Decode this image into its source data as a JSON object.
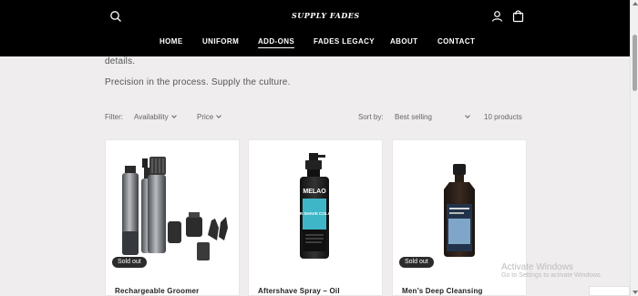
{
  "header": {
    "logo_text": "SUPPLY FADES",
    "nav": [
      {
        "label": "HOME"
      },
      {
        "label": "UNIFORM"
      },
      {
        "label": "ADD-ONS"
      },
      {
        "label": "FADES LEGACY"
      },
      {
        "label": "ABOUT"
      },
      {
        "label": "CONTACT"
      }
    ],
    "active_nav": "ADD-ONS",
    "icons": [
      "search-icon",
      "account-icon",
      "cart-icon"
    ]
  },
  "intro": {
    "line1": "details.",
    "line2": "Precision in the process. Supply the culture."
  },
  "filters": {
    "label": "Filter:",
    "availability": "Availability",
    "price": "Price",
    "sort_label": "Sort by:",
    "sort_value": "Best selling",
    "count": "10 products"
  },
  "products": [
    {
      "title": "Rechargeable Groomer",
      "badge": "Sold out"
    },
    {
      "title": "Aftershave Spray – Oil",
      "badge": "",
      "bottle_label": "AFTER SHAVE COLOGNE",
      "brand": "MELAO"
    },
    {
      "title": "Men’s Deep Cleansing",
      "badge": "Sold out"
    }
  ],
  "watermark": {
    "title": "Activate Windows",
    "subtitle": "Go to Settings to activate Windows."
  },
  "colors": {
    "header_bg": "#000000",
    "page_bg": "#efeded",
    "badge_bg": "#2b2b2b"
  }
}
